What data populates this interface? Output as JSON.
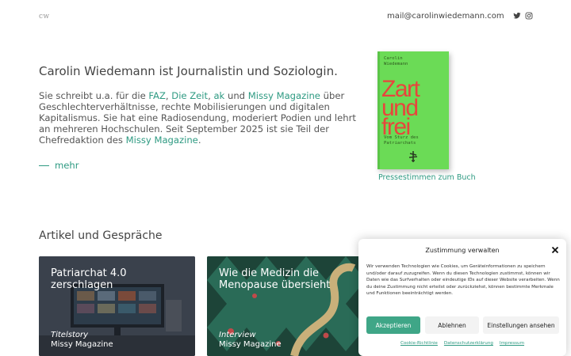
{
  "header": {
    "logo": "cw",
    "email": "mail@carolinwiedemann.com",
    "social": [
      {
        "icon": "twitter-icon"
      },
      {
        "icon": "instagram-icon"
      }
    ]
  },
  "intro": {
    "headline": "Carolin Wiedemann ist Journalistin und Soziologin.",
    "bio": {
      "t1": "Sie schreibt u.a. für die ",
      "l1": "FAZ",
      "t2": ", ",
      "l2": "Die Zeit",
      "t3": ", ",
      "l3": "ak",
      "t4": " und ",
      "l4": "Missy Magazine",
      "t5": " über Geschlechterverhältnisse, rechte Mobilisierungen und digitalen Kapitalismus. Sie hat eine Radiosendung, moderiert Podien und lehrt an mehreren Hochschulen. Seit September 2025 ist sie Teil der Chefredaktion des ",
      "l5": "Missy Magazine",
      "t6": "."
    },
    "more_label": "mehr"
  },
  "book": {
    "author_line1": "Carolin",
    "author_line2": "Wiedemann",
    "title_line1": "Zart",
    "title_line2": "und",
    "title_line3": "frei",
    "subtitle_line1": "Vom Sturz des",
    "subtitle_line2": "Patriarchats",
    "press_link": "Pressestimmen zum Buch",
    "cover_color": "#6bdb56",
    "title_color": "#e8453c"
  },
  "articles": {
    "heading": "Artikel und Gespräche",
    "cards": [
      {
        "title": "Patriarchat 4.0 zerschlagen",
        "type": "Titelstory",
        "publication": "Missy Magazine"
      },
      {
        "title": "Wie die Medizin die Menopause übersieht",
        "type": "Interview",
        "publication": "Missy Magazine"
      }
    ]
  },
  "cookie": {
    "title": "Zustimmung verwalten",
    "text": "Wir verwenden Technologien wie Cookies, um Geräteinformationen zu speichern und/oder darauf zuzugreifen. Wenn du diesen Technologien zustimmst, können wir Daten wie das Surfverhalten oder eindeutige IDs auf dieser Website verarbeiten. Wenn du deine Zustimmung nicht erteilst oder zurückziehst, können bestimmte Merkmale und Funktionen beeinträchtigt werden.",
    "accept_label": "Akzeptieren",
    "deny_label": "Ablehnen",
    "prefs_label": "Einstellungen ansehen",
    "links": [
      "Cookie-Richtlinie",
      "Datenschutzerklärung",
      "Impressum"
    ]
  },
  "colors": {
    "accent": "#2e9a82",
    "accept_button": "#3fa687"
  }
}
